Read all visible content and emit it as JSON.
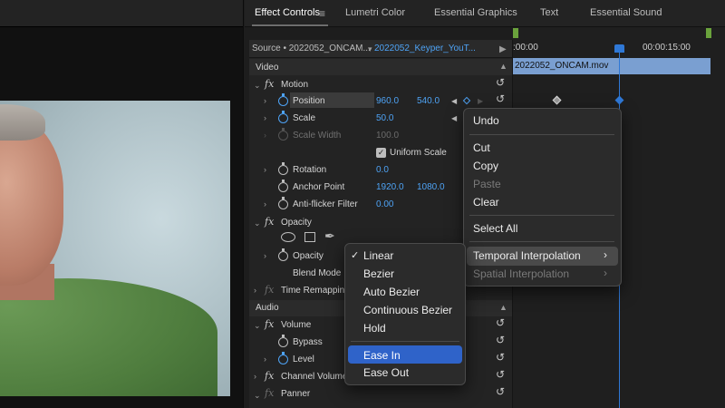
{
  "tabs": {
    "effect_controls": "Effect Controls",
    "lumetri_color": "Lumetri Color",
    "essential_graphics": "Essential Graphics",
    "text": "Text",
    "essential_sound": "Essential Sound"
  },
  "source_bar": {
    "source": "Source • 2022052_ONCAM...",
    "sequence": "2022052_Keyper_YouT..."
  },
  "timeline": {
    "time_start": ":00:00",
    "time_end": "00:00:15:00",
    "clip_name": "2022052_ONCAM.mov"
  },
  "sections": {
    "video": "Video",
    "audio": "Audio"
  },
  "effects": {
    "motion": "Motion",
    "opacity": "Opacity",
    "time_remapping": "Time Remappin",
    "volume": "Volume",
    "channel_volume": "Channel Volume",
    "panner": "Panner"
  },
  "motion": {
    "position_label": "Position",
    "position_x": "960.0",
    "position_y": "540.0",
    "scale_label": "Scale",
    "scale_value": "50.0",
    "scale_width_label": "Scale Width",
    "scale_width_value": "100.0",
    "uniform_scale_label": "Uniform Scale",
    "rotation_label": "Rotation",
    "rotation_value": "0.0",
    "anchor_label": "Anchor Point",
    "anchor_x": "1920.0",
    "anchor_y": "1080.0",
    "antiflicker_label": "Anti-flicker Filter",
    "antiflicker_value": "0.00"
  },
  "opacity": {
    "opacity_label": "Opacity",
    "blend_mode_label": "Blend Mode"
  },
  "audio": {
    "bypass_label": "Bypass",
    "level_label": "Level"
  },
  "context_menu": {
    "undo": "Undo",
    "cut": "Cut",
    "copy": "Copy",
    "paste": "Paste",
    "clear": "Clear",
    "select_all": "Select All",
    "temporal": "Temporal Interpolation",
    "spatial": "Spatial Interpolation"
  },
  "submenu": {
    "checkmark": "✓",
    "linear": "Linear",
    "bezier": "Bezier",
    "auto_bezier": "Auto Bezier",
    "continuous_bezier": "Continuous Bezier",
    "hold": "Hold",
    "ease_in": "Ease In",
    "ease_out": "Ease Out"
  },
  "colors": {
    "accent_blue": "#4ea3f5",
    "menu_highlight": "#2f63c9",
    "clip_bar": "#7a9fd1",
    "playhead": "#2f78d6"
  }
}
